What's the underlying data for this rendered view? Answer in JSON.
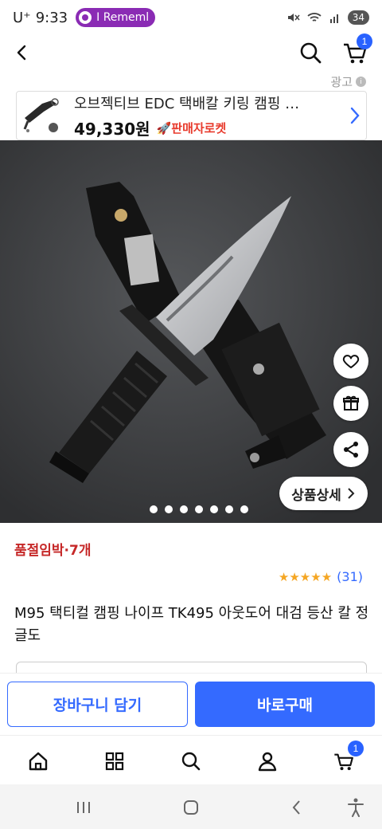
{
  "status_bar": {
    "carrier": "U⁺",
    "time": "9:33",
    "notification_pill": "I Rememl",
    "battery": "34"
  },
  "header": {
    "cart_badge": "1"
  },
  "ad": {
    "label": "광고",
    "title": "오브젝티브 EDC 택배칼 키링 캠핑 …",
    "price": "49,330원",
    "seller_tag": "판매자로켓"
  },
  "product": {
    "stock_notice": "품절임박·7개",
    "rating_stars": "★★★★★",
    "review_count": "(31)",
    "rating_value": 5,
    "title": "M95 택티컬 캠핑 나이프 TK495 아웃도어 대검 등산 칼 정글도",
    "detail_button": "상품상세",
    "image_count": 7
  },
  "actions": {
    "add_to_cart": "장바구니 담기",
    "buy_now": "바로구매"
  },
  "tabbar": {
    "cart_badge": "1"
  },
  "colors": {
    "accent": "#346aff",
    "stock_red": "#c62828",
    "star": "#f5a623",
    "rocket": "#e83a2c"
  }
}
